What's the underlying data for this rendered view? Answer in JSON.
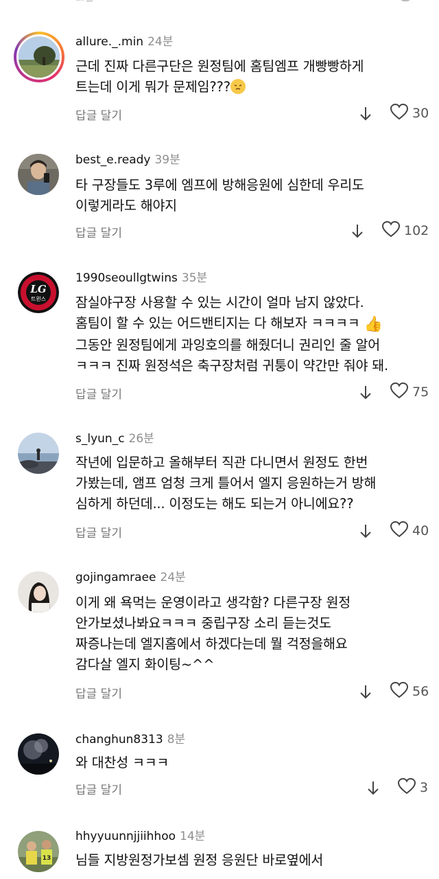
{
  "labels": {
    "reply": "답글 달기"
  },
  "colors": {
    "meta_text": "#8e8e8e",
    "story_ring": [
      "#f8c02c",
      "#e1306c",
      "#833ab4"
    ]
  },
  "comments": [
    {
      "username": "allure._.min",
      "time": "24분",
      "lines": [
        "근데 진짜 다른구단은 원정팀에 홈팀엠프 개빵빵하게",
        "트는데 이게 뭐가 문제임???"
      ],
      "emoji": "pensive-face",
      "likes": "30",
      "avatar": "landscape-tree-photo",
      "story_ring": true
    },
    {
      "username": "best_e.ready",
      "time": "39분",
      "lines": [
        "타 구장들도 3루에 엠프에 방해응원에 심한데 우리도",
        "이렇게라도 해야지"
      ],
      "likes": "102",
      "avatar": "person-selfie-photo"
    },
    {
      "username": "1990seoullgtwins",
      "time": "35분",
      "lines": [
        "잠실야구장 사용할 수 있는 시간이 얼마 남지 않았다.",
        "홈팀이 할 수 있는 어드밴티지는 다 해보자 ㅋㅋㅋㅋ",
        "그동안 원정팀에게 과잉호의를 해줬더니 권리인 줄 알어",
        "ㅋㅋㅋ 진짜 원정석은 축구장처럼 귀퉁이 약간만 줘야 돼."
      ],
      "emoji": "thumbs-up",
      "likes": "75",
      "avatar": "lg-twins-logo",
      "logo_text": "LG",
      "logo_sub": "트윈스"
    },
    {
      "username": "s_lyun_c",
      "time": "26분",
      "lines": [
        "작년에 입문하고 올해부터 직관 다니면서 원정도 한번",
        "가봤는데, 앰프 엄청 크게 틀어서 엘지 응원하는거 방해",
        "심하게 하던데... 이정도는 해도 되는거 아니에요??"
      ],
      "likes": "40",
      "avatar": "seaside-photo"
    },
    {
      "username": "gojingamraee",
      "time": "24분",
      "lines": [
        "이게 왜 욕먹는 운영이라고 생각함? 다른구장 원정",
        "안가보셨나봐요ㅋㅋㅋ 중립구장 소리 듣는것도",
        "짜증나는데 엘지홈에서 하겠다는데 뭘 걱정을해요",
        "감다살 엘지 화이팅~^^"
      ],
      "likes": "56",
      "avatar": "girl-portrait-photo"
    },
    {
      "username": "changhun8313",
      "time": "8분",
      "lines": [
        "와 대찬성 ㅋㅋㅋ"
      ],
      "likes": "3",
      "avatar": "night-blossom-photo"
    },
    {
      "username": "hhyyuunnjjiihhoo",
      "time": "14분",
      "lines": [
        "님들 지방원정가보셈 원정 응원단 바로옆에서"
      ],
      "avatar": "baseball-kids-photo",
      "jersey_number": "13"
    }
  ]
}
